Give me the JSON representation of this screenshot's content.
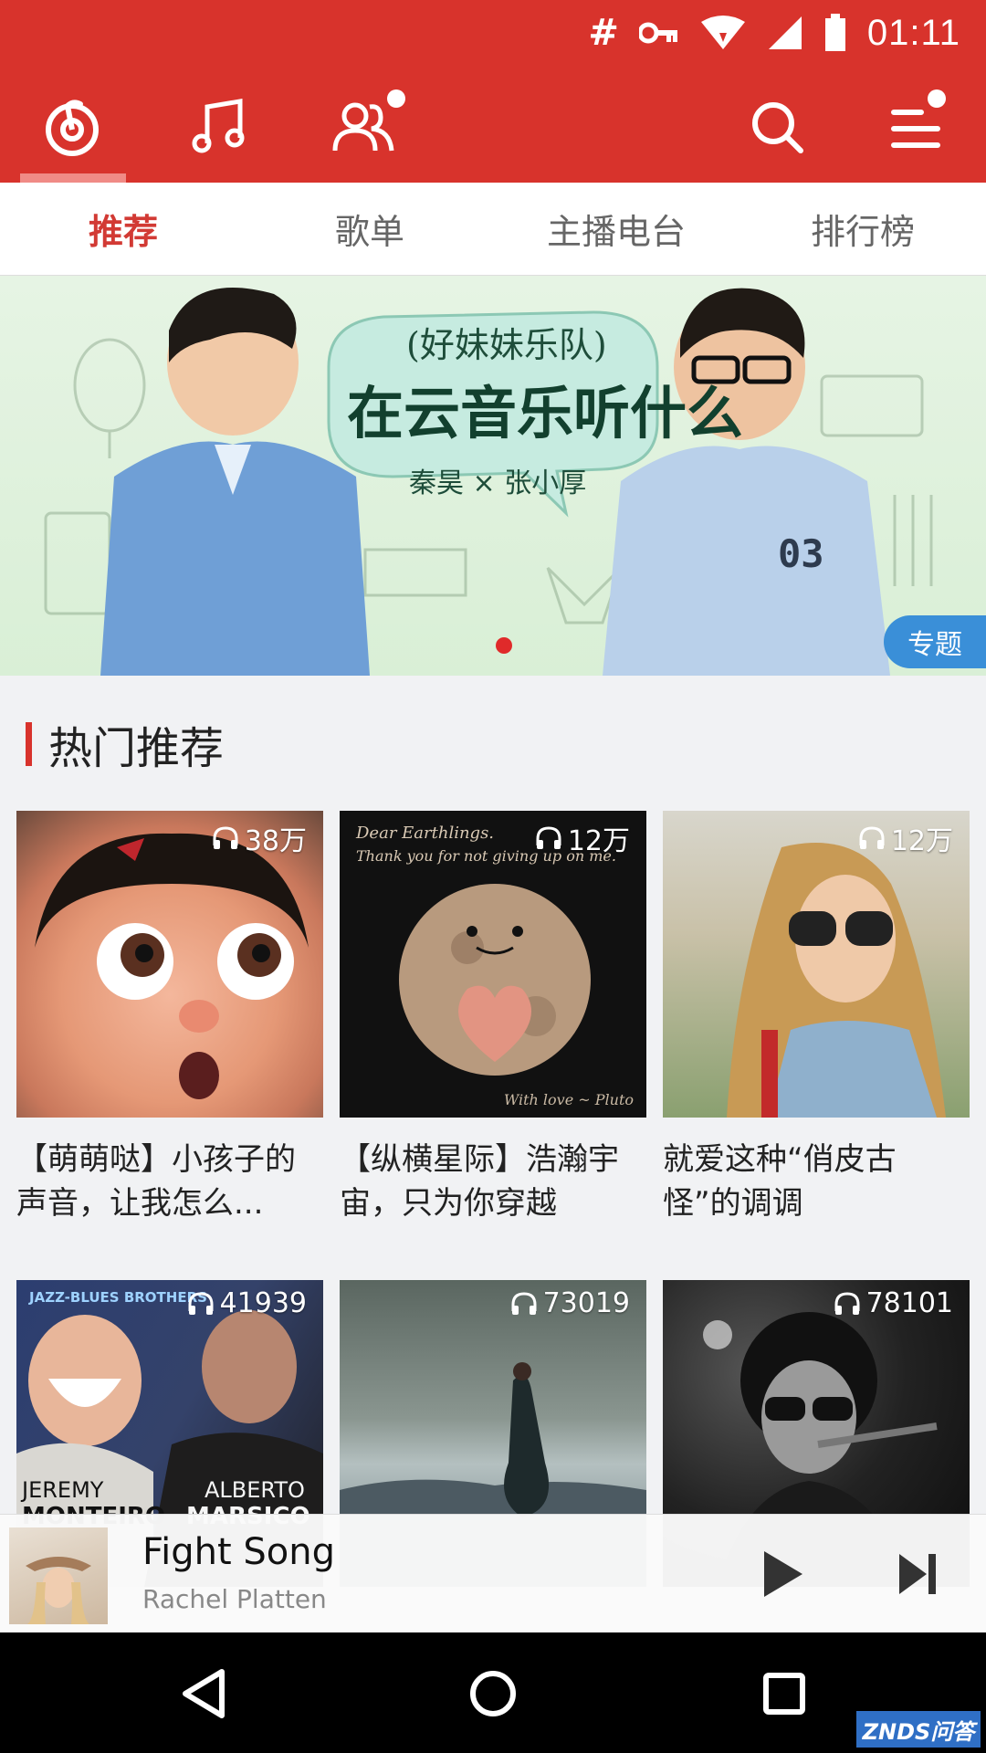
{
  "status_bar": {
    "hash_symbol": "#",
    "time": "01:11",
    "icons": [
      "key-icon",
      "wifi-icon",
      "signal-icon",
      "battery-icon"
    ]
  },
  "top_bar": {
    "icons": [
      "netease-logo-icon",
      "music-note-icon",
      "friends-icon",
      "search-icon",
      "menu-icon"
    ],
    "accent_color": "#d8332c"
  },
  "sub_tabs": [
    {
      "label": "推荐",
      "active": true
    },
    {
      "label": "歌单",
      "active": false
    },
    {
      "label": "主播电台",
      "active": false
    },
    {
      "label": "排行榜",
      "active": false
    }
  ],
  "banner": {
    "title_line1": "(好妹妹乐队)",
    "title_line2": "在云音乐听什么",
    "subtitle": "秦昊 × 张小厚",
    "tag": "专题",
    "jersey_number": "03"
  },
  "section": {
    "title": "热门推荐"
  },
  "cards": [
    {
      "count": "38万",
      "title": "【萌萌哒】小孩子的声音，让我怎么..."
    },
    {
      "count": "12万",
      "title": "【纵横星际】浩瀚宇宙，只为你穿越",
      "cover_text_1": "Dear Earthlings.",
      "cover_text_2": "Thank you for not giving up on me.",
      "cover_text_3": "With love ~ Pluto"
    },
    {
      "count": "12万",
      "title": "就爱这种“俏皮古怪”的调调"
    },
    {
      "count": "41939",
      "cover_text_1": "JAZZ-BLUES BROTHERS",
      "cover_text_2": "JEREMY",
      "cover_text_3": "ALBERTO",
      "cover_text_4": "MONTEIRO",
      "cover_text_5": "MARSICO"
    },
    {
      "count": "73019"
    },
    {
      "count": "78101"
    }
  ],
  "mini_player": {
    "title": "Fight Song",
    "artist": "Rachel Platten"
  },
  "nav_bar": {
    "icons": [
      "back-icon",
      "home-icon",
      "recents-icon"
    ]
  },
  "watermark": "ZNDS问答"
}
